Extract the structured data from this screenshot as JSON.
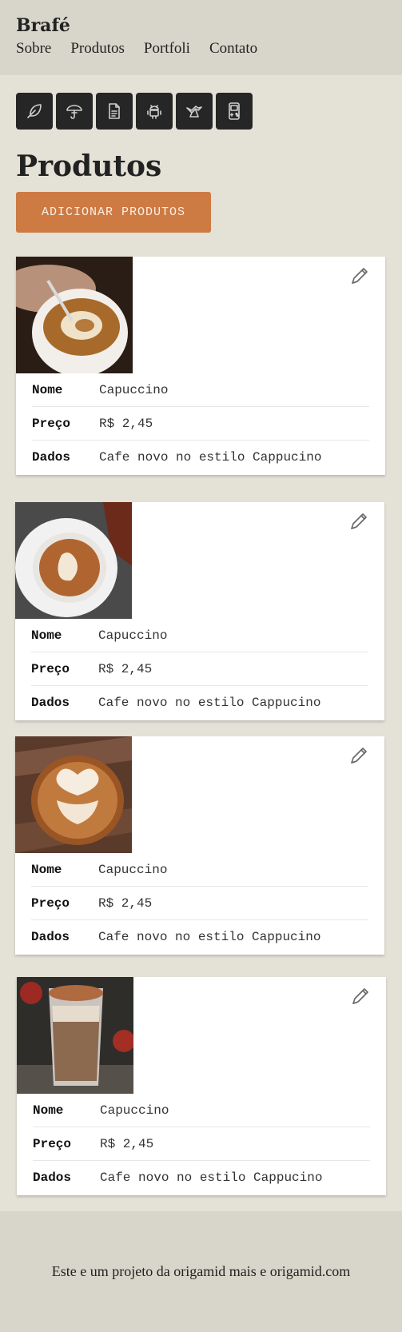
{
  "header": {
    "brand": "Brafé",
    "nav": [
      "Sobre",
      "Produtos",
      "Portfoli",
      "Contato"
    ]
  },
  "icons": [
    "feather-icon",
    "umbrella-icon",
    "document-icon",
    "android-icon",
    "bird-icon",
    "gameboy-icon"
  ],
  "page": {
    "title": "Produtos",
    "add_button": "ADICIONAR PRODUTOS"
  },
  "labels": {
    "nome": "Nome",
    "preco": "Preço",
    "dados": "Dados"
  },
  "products": [
    {
      "nome": "Capuccino",
      "preco": "R$ 2,45",
      "dados": "Cafe novo no estilo Cappucino"
    },
    {
      "nome": "Capuccino",
      "preco": "R$ 2,45",
      "dados": "Cafe novo no estilo Cappucino"
    },
    {
      "nome": "Capuccino",
      "preco": "R$ 2,45",
      "dados": "Cafe novo no estilo Cappucino"
    },
    {
      "nome": "Capuccino",
      "preco": "R$ 2,45",
      "dados": "Cafe novo no estilo Cappucino"
    }
  ],
  "footer": {
    "text": "Este e um projeto da origamid mais e origamid.com"
  },
  "colors": {
    "accent": "#cd7a43",
    "header_bg": "#d8d5ca",
    "page_bg": "#e4e1d6",
    "icon_bg": "#262626"
  }
}
